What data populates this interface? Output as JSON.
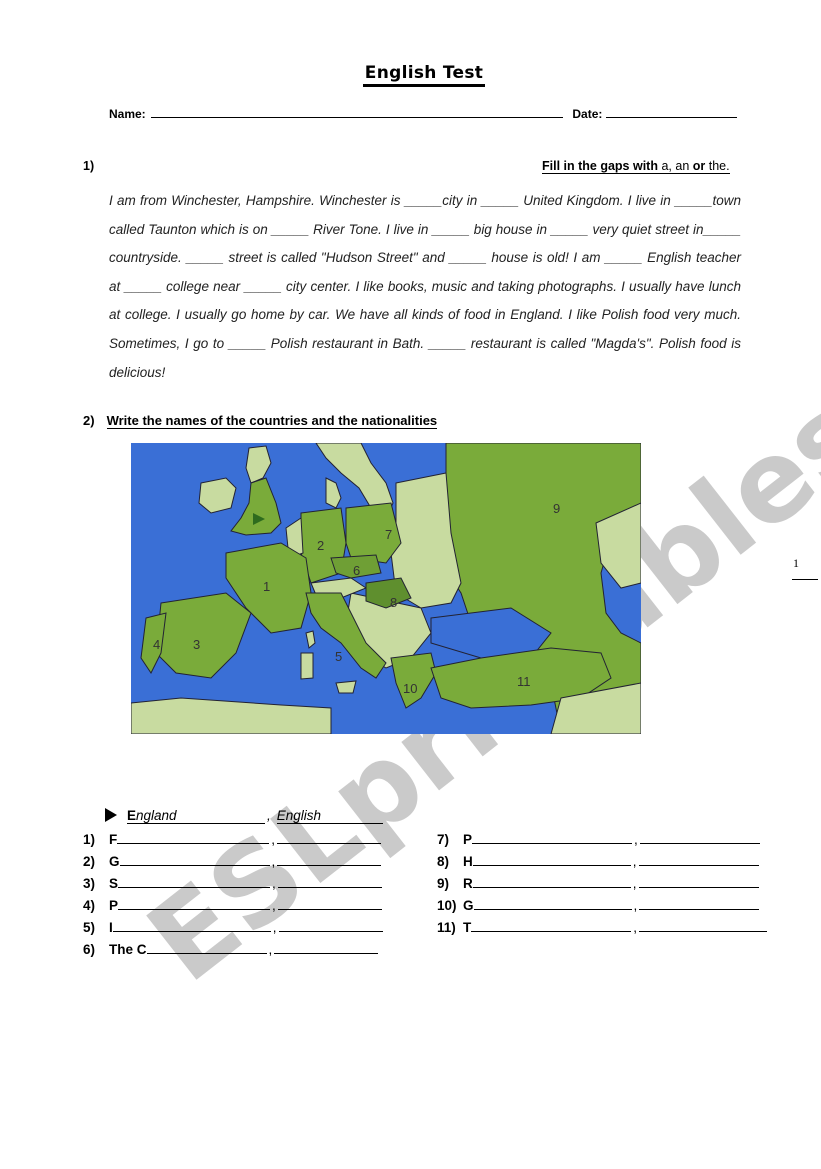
{
  "header": {
    "title": "English Test",
    "name_label": "Name:",
    "date_label": "Date:"
  },
  "section1": {
    "number": "1)",
    "instruction_prefix": "Fill in the gaps with",
    "instruction_a_an": "a, an",
    "instruction_or": "or",
    "instruction_the": "the.",
    "paragraph": "I am from Winchester, Hampshire. Winchester is _____city in _____ United Kingdom.  I live in _____town called Taunton which is on _____ River Tone. I live in _____ big house in _____ very quiet street in_____ countryside. _____ street is called \"Hudson Street\" and _____ house is old! I am _____ English teacher at _____ college near _____ city center. I like books, music and taking photographs. I usually have lunch at college. I usually go home by car. We have all kinds of food in England. I like Polish food very much. Sometimes, I go to _____ Polish restaurant in Bath. _____ restaurant is called \"Magda's\". Polish food is delicious!"
  },
  "section2": {
    "number": "2)",
    "instruction": "Write the names of the countries and the nationalities",
    "map": {
      "labels": [
        "1",
        "2",
        "3",
        "4",
        "5",
        "6",
        "7",
        "8",
        "9",
        "10",
        "11"
      ],
      "colors": {
        "sea": "#3a6fd6",
        "highlight": "#7aab3a",
        "other_land": "#c8dba0",
        "dark_green": "#5f8f2e"
      }
    },
    "example": {
      "country_first": "E",
      "country_rest": "ngland",
      "separator": ",",
      "nationality": "English"
    },
    "left_items": [
      {
        "num": "1)",
        "hint": "F"
      },
      {
        "num": "2)",
        "hint": "G"
      },
      {
        "num": "3)",
        "hint": "S"
      },
      {
        "num": "4)",
        "hint": "P"
      },
      {
        "num": "5)",
        "hint": "I"
      },
      {
        "num": "6)",
        "hint": "The C"
      }
    ],
    "right_items": [
      {
        "num": "7)",
        "hint": "P"
      },
      {
        "num": "8)",
        "hint": "H"
      },
      {
        "num": "9)",
        "hint": "R"
      },
      {
        "num": "10)",
        "hint": "G"
      },
      {
        "num": "11)",
        "hint": "T"
      }
    ],
    "comma": ","
  },
  "page": {
    "number": "1"
  },
  "watermark": "ESLprintables.com"
}
